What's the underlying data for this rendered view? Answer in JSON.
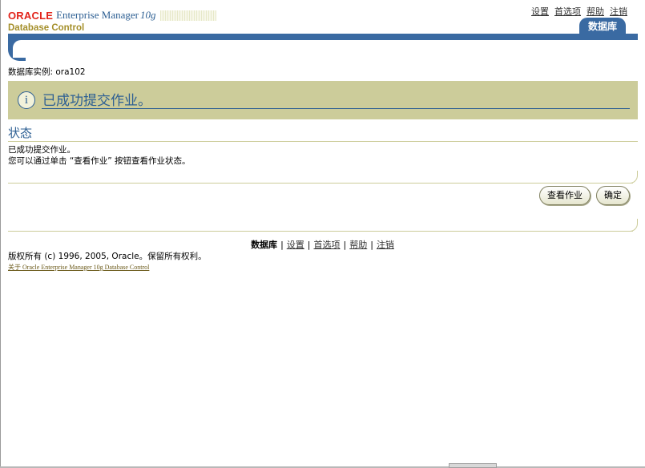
{
  "header": {
    "brand": "ORACLE",
    "product": "Enterprise Manager",
    "version": "10g",
    "subtitle": "Database Control"
  },
  "global_links": [
    "设置",
    "首选项",
    "帮助",
    "注销"
  ],
  "active_tab": "数据库",
  "instance_label": "数据库实例: ora102",
  "confirmation": {
    "icon": "info-icon",
    "message": "已成功提交作业。"
  },
  "status": {
    "title": "状态",
    "line1": "已成功提交作业。",
    "line2": "您可以通过单击 “查看作业” 按钮查看作业状态。"
  },
  "buttons": {
    "view_job": "查看作业",
    "ok": "确定"
  },
  "footer": {
    "current": "数据库",
    "links": [
      "设置",
      "首选项",
      "帮助",
      "注销"
    ],
    "separator": "|",
    "copyright": "版权所有 (c) 1996, 2005, Oracle。保留所有权利。",
    "about": "关于 Oracle Enterprise Manager 10g Database Control"
  },
  "colors": {
    "brand_blue": "#3a6aa2",
    "oracle_red": "#e2231a",
    "khaki": "#cccc9a"
  }
}
